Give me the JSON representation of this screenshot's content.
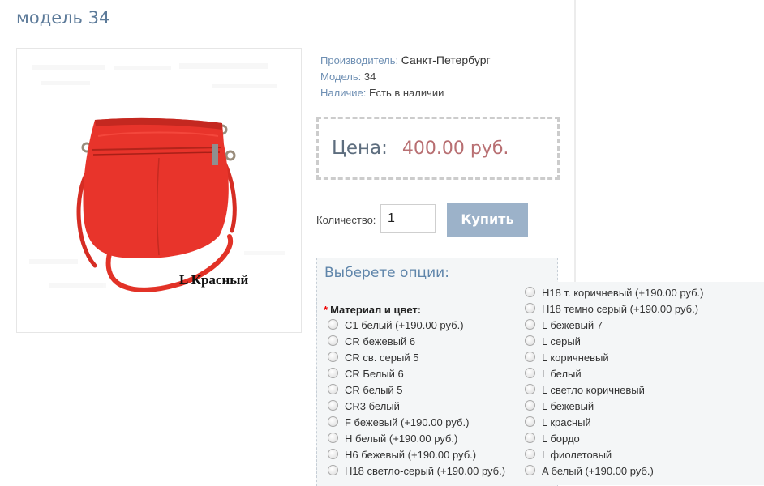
{
  "product": {
    "title": "модель 34",
    "image_caption": "L Красный"
  },
  "info": {
    "manufacturer_label": "Производитель:",
    "manufacturer_value": "Санкт-Петербург",
    "model_label": "Модель:",
    "model_value": "34",
    "availability_label": "Наличие:",
    "availability_value": "Есть в наличии"
  },
  "price": {
    "label": "Цена:",
    "value": "400.00 руб."
  },
  "purchase": {
    "qty_label": "Количество:",
    "qty_value": "1",
    "buy_label": "Купить"
  },
  "options": {
    "title": "Выберете опции:",
    "required_mark": "*",
    "group_label": "Материал и цвет:",
    "left_column": [
      "С1 белый (+190.00 руб.)",
      "CR бежевый 6",
      "CR св. серый 5",
      "CR Белый 6",
      "CR белый 5",
      "CR3 белый",
      "F бежевый (+190.00 руб.)",
      "H белый (+190.00 руб.)",
      "H6 бежевый (+190.00 руб.)",
      "H18 светло-серый (+190.00 руб.)"
    ],
    "right_column": [
      "H18 т. коричневый (+190.00 руб.)",
      "H18 темно серый (+190.00 руб.)",
      "L бежевый 7",
      "L серый",
      "L коричневый",
      "L белый",
      "L светло коричневый",
      "L бежевый",
      "L красный",
      "L бордо",
      "L фиолетовый",
      "A белый (+190.00 руб.)"
    ]
  },
  "colors": {
    "title": "#5c7a99",
    "label": "#6e8fb3",
    "price": "#b86f72",
    "button": "#9cb2c9",
    "options_bg": "#f4f6f7",
    "bag": "#e8342b"
  }
}
